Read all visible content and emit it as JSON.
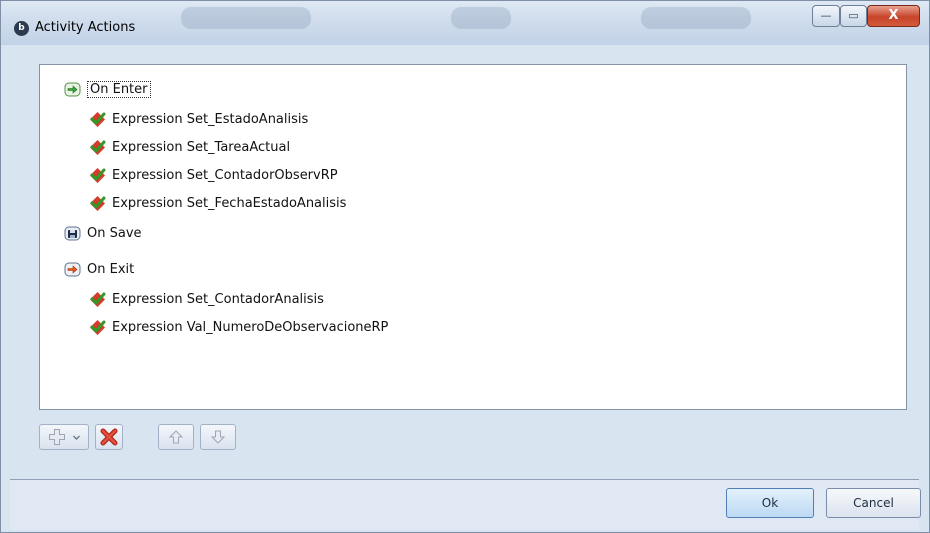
{
  "window": {
    "title": "Activity Actions",
    "app_icon_glyph": "b",
    "minimize_glyph": "—",
    "maximize_glyph": "▭",
    "close_glyph": "X"
  },
  "tree": {
    "on_enter": {
      "label": "On Enter",
      "icon": "enter-arrow-icon",
      "items": [
        "Expression Set_EstadoAnalisis",
        "Expression Set_TareaActual",
        "Expression Set_ContadorObservRP",
        "Expression Set_FechaEstadoAnalisis"
      ]
    },
    "on_save": {
      "label": "On Save",
      "icon": "save-disk-icon"
    },
    "on_exit": {
      "label": "On Exit",
      "icon": "exit-arrow-icon",
      "items": [
        "Expression Set_ContadorAnalisis",
        "Expression Val_NumeroDeObservacioneRP"
      ]
    },
    "expression_icon": "checkmark-diamond-icon"
  },
  "toolbar": {
    "add_icon": "plus-icon",
    "dropdown_icon": "chevron-down-icon",
    "delete_icon": "red-x-icon",
    "move_up_icon": "arrow-up-icon",
    "move_down_icon": "arrow-down-icon"
  },
  "buttons": {
    "ok": "Ok",
    "cancel": "Cancel"
  },
  "colors": {
    "window_bg": "#d9e4f1",
    "panel_bg": "#ffffff",
    "close_red": "#c7442a",
    "ok_blue": "#bcd9f3",
    "expression_red": "#d63a2a",
    "expression_green": "#2f9a25"
  }
}
